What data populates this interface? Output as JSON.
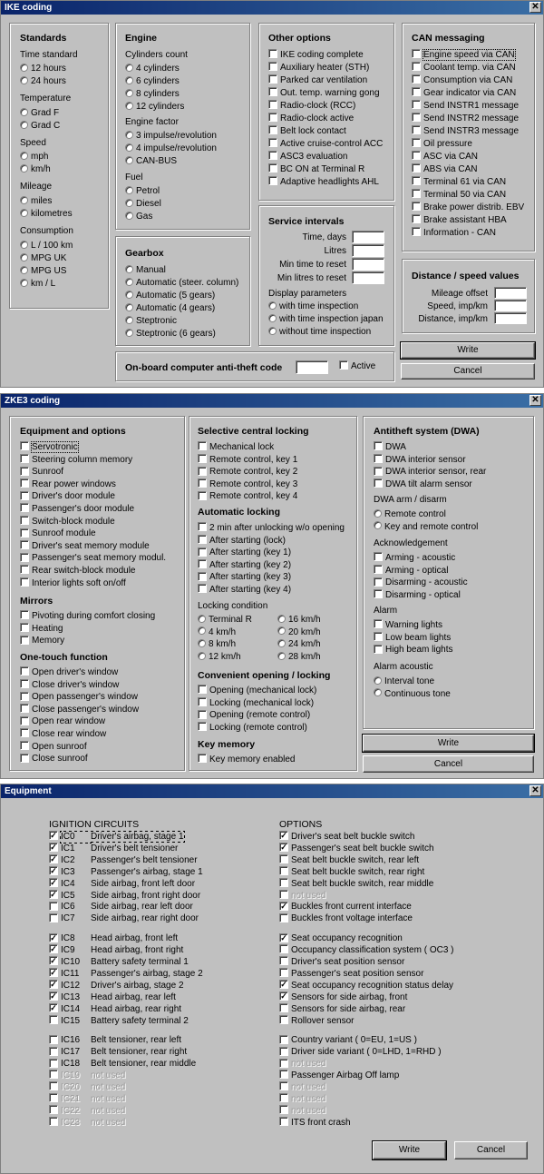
{
  "ike": {
    "title": "IKE coding",
    "standards": {
      "heading": "Standards",
      "time_label": "Time standard",
      "time_opts": [
        "12 hours",
        "24 hours"
      ],
      "temp_label": "Temperature",
      "temp_opts": [
        "Grad F",
        "Grad C"
      ],
      "speed_label": "Speed",
      "speed_opts": [
        "mph",
        "km/h"
      ],
      "mileage_label": "Mileage",
      "mileage_opts": [
        "miles",
        "kilometres"
      ],
      "cons_label": "Consumption",
      "cons_opts": [
        "L / 100 km",
        "MPG UK",
        "MPG US",
        "km / L"
      ]
    },
    "engine": {
      "heading": "Engine",
      "cyl_label": "Cylinders count",
      "cyl_opts": [
        "4 cylinders",
        "6 cylinders",
        "8 cylinders",
        "12 cylinders"
      ],
      "factor_label": "Engine factor",
      "factor_opts": [
        "3 impulse/revolution",
        "4 impulse/revolution",
        "CAN-BUS"
      ],
      "fuel_label": "Fuel",
      "fuel_opts": [
        "Petrol",
        "Diesel",
        "Gas"
      ]
    },
    "gearbox": {
      "heading": "Gearbox",
      "opts": [
        "Manual",
        "Automatic (steer. column)",
        "Automatic (5 gears)",
        "Automatic (4 gears)",
        "Steptronic",
        "Steptronic (6 gears)"
      ]
    },
    "other": {
      "heading": "Other options",
      "items": [
        "IKE coding complete",
        "Auxiliary heater (STH)",
        "Parked car ventilation",
        "Out. temp. warning gong",
        "Radio-clock (RCC)",
        "Radio-clock active",
        "Belt lock contact",
        "Active cruise-control ACC",
        "ASC3 evaluation",
        "BC ON at Terminal R",
        "Adaptive headlights AHL"
      ]
    },
    "service": {
      "heading": "Service intervals",
      "fields": [
        "Time, days",
        "Litres",
        "Min time to reset",
        "Min litres to reset"
      ],
      "display_label": "Display parameters",
      "display_opts": [
        "with time inspection",
        "with time inspection japan",
        "without time inspection"
      ]
    },
    "can": {
      "heading": "CAN messaging",
      "items": [
        "Engine speed via CAN",
        "Coolant temp. via CAN",
        "Consumption via CAN",
        "Gear indicator via CAN",
        "Send INSTR1 message",
        "Send INSTR2 message",
        "Send INSTR3 message",
        "Oil pressure",
        "ASC via CAN",
        "ABS via CAN",
        "Terminal 61 via CAN",
        "Terminal 50 via CAN",
        "Brake power distrib. EBV",
        "Brake assistant HBA",
        "Information - CAN"
      ]
    },
    "distance": {
      "heading": "Distance / speed values",
      "fields": [
        "Mileage offset",
        "Speed, imp/km",
        "Distance, imp/km"
      ]
    },
    "antitheft": {
      "label": "On-board computer anti-theft code",
      "active": "Active"
    },
    "write": "Write",
    "cancel": "Cancel"
  },
  "zke": {
    "title": "ZKE3 coding",
    "equipment": {
      "heading": "Equipment and options",
      "items": [
        "Servotronic",
        "Steering column memory",
        "Sunroof",
        "Rear power windows",
        "Driver's door module",
        "Passenger's door module",
        "Switch-block module",
        "Sunroof module",
        "Driver's seat memory module",
        "Passenger's seat memory modul.",
        "Rear switch-block module",
        "Interior lights soft on/off"
      ]
    },
    "mirrors": {
      "heading": "Mirrors",
      "items": [
        "Pivoting during comfort closing",
        "Heating",
        "Memory"
      ]
    },
    "onetouch": {
      "heading": "One-touch function",
      "items": [
        "Open driver's window",
        "Close driver's window",
        "Open passenger's window",
        "Close passenger's window",
        "Open rear window",
        "Close rear window",
        "Open sunroof",
        "Close sunroof"
      ]
    },
    "selective": {
      "heading": "Selective central locking",
      "items": [
        "Mechanical lock",
        "Remote control, key 1",
        "Remote control, key 2",
        "Remote control, key 3",
        "Remote control, key 4"
      ]
    },
    "autolock": {
      "heading": "Automatic locking",
      "items": [
        "2 min after unlocking w/o opening",
        "After starting (lock)",
        "After starting (key 1)",
        "After starting (key 2)",
        "After starting (key 3)",
        "After starting (key 4)"
      ]
    },
    "lockcond": {
      "label": "Locking condition",
      "left": [
        "Terminal R",
        "4 km/h",
        "8 km/h",
        "12 km/h"
      ],
      "right": [
        "16 km/h",
        "20 km/h",
        "24 km/h",
        "28 km/h"
      ]
    },
    "convenient": {
      "heading": "Convenient opening / locking",
      "items": [
        "Opening (mechanical lock)",
        "Locking (mechanical lock)",
        "Opening (remote control)",
        "Locking (remote control)"
      ]
    },
    "keymem": {
      "heading": "Key memory",
      "items": [
        "Key memory enabled"
      ]
    },
    "dwa": {
      "heading": "Antitheft system (DWA)",
      "items": [
        "DWA",
        "DWA interior sensor",
        "DWA interior sensor, rear",
        "DWA tilt alarm sensor"
      ],
      "arm_label": "DWA arm / disarm",
      "arm_opts": [
        "Remote control",
        "Key and remote control"
      ],
      "ack_label": "Acknowledgement",
      "ack_items": [
        "Arming - acoustic",
        "Arming - optical",
        "Disarming - acoustic",
        "Disarming - optical"
      ],
      "alarm_label": "Alarm",
      "alarm_items": [
        "Warning lights",
        "Low beam lights",
        "High beam lights"
      ],
      "acoustic_label": "Alarm acoustic",
      "acoustic_opts": [
        "Interval tone",
        "Continuous tone"
      ]
    },
    "write": "Write",
    "cancel": "Cancel"
  },
  "equip": {
    "title": "Equipment",
    "ign_heading": "IGNITION CIRCUITS",
    "opt_heading": "OPTIONS",
    "ignition": [
      {
        "code": "IC0",
        "label": "Driver's airbag, stage 1",
        "checked": true,
        "disabled": false
      },
      {
        "code": "IC1",
        "label": "Driver's belt tensioner",
        "checked": true,
        "disabled": false
      },
      {
        "code": "IC2",
        "label": "Passenger's belt tensioner",
        "checked": true,
        "disabled": false
      },
      {
        "code": "IC3",
        "label": "Passenger's airbag, stage 1",
        "checked": true,
        "disabled": false
      },
      {
        "code": "IC4",
        "label": "Side airbag, front left door",
        "checked": true,
        "disabled": false
      },
      {
        "code": "IC5",
        "label": "Side airbag, front right door",
        "checked": true,
        "disabled": false
      },
      {
        "code": "IC6",
        "label": "Side airbag, rear left door",
        "checked": false,
        "disabled": false
      },
      {
        "code": "IC7",
        "label": "Side airbag, rear right door",
        "checked": false,
        "disabled": false
      },
      {
        "code": "IC8",
        "label": "Head airbag, front left",
        "checked": true,
        "disabled": false
      },
      {
        "code": "IC9",
        "label": "Head airbag, front right",
        "checked": true,
        "disabled": false
      },
      {
        "code": "IC10",
        "label": "Battery safety terminal 1",
        "checked": true,
        "disabled": false
      },
      {
        "code": "IC11",
        "label": "Passenger's airbag, stage 2",
        "checked": true,
        "disabled": false
      },
      {
        "code": "IC12",
        "label": "Driver's airbag, stage 2",
        "checked": true,
        "disabled": false
      },
      {
        "code": "IC13",
        "label": "Head airbag, rear left",
        "checked": true,
        "disabled": false
      },
      {
        "code": "IC14",
        "label": "Head airbag, rear right",
        "checked": true,
        "disabled": false
      },
      {
        "code": "IC15",
        "label": "Battery safety terminal 2",
        "checked": false,
        "disabled": false
      },
      {
        "code": "IC16",
        "label": "Belt tensioner, rear left",
        "checked": false,
        "disabled": false
      },
      {
        "code": "IC17",
        "label": "Belt tensioner, rear right",
        "checked": false,
        "disabled": false
      },
      {
        "code": "IC18",
        "label": "Belt tensioner, rear middle",
        "checked": false,
        "disabled": false
      },
      {
        "code": "IC19",
        "label": "not used",
        "checked": false,
        "disabled": true
      },
      {
        "code": "IC20",
        "label": "not used",
        "checked": false,
        "disabled": true
      },
      {
        "code": "IC21",
        "label": "not used",
        "checked": false,
        "disabled": true
      },
      {
        "code": "IC22",
        "label": "not used",
        "checked": false,
        "disabled": true
      },
      {
        "code": "IC23",
        "label": "not used",
        "checked": false,
        "disabled": true
      }
    ],
    "options": [
      {
        "label": "Driver's seat belt buckle switch",
        "checked": true,
        "disabled": false
      },
      {
        "label": "Passenger's seat belt buckle switch",
        "checked": true,
        "disabled": false
      },
      {
        "label": "Seat belt buckle switch, rear left",
        "checked": false,
        "disabled": false
      },
      {
        "label": "Seat belt buckle switch, rear right",
        "checked": false,
        "disabled": false
      },
      {
        "label": "Seat belt buckle switch, rear middle",
        "checked": false,
        "disabled": false
      },
      {
        "label": "not used",
        "checked": false,
        "disabled": true
      },
      {
        "label": "Buckles front current interface",
        "checked": true,
        "disabled": false
      },
      {
        "label": "Buckles front voltage interface",
        "checked": false,
        "disabled": false
      },
      {
        "label": "Seat occupancy recognition",
        "checked": true,
        "disabled": false
      },
      {
        "label": "Occupancy classification system ( OC3 )",
        "checked": false,
        "disabled": false
      },
      {
        "label": "Driver's seat position sensor",
        "checked": false,
        "disabled": false
      },
      {
        "label": "Passenger's seat position sensor",
        "checked": false,
        "disabled": false
      },
      {
        "label": "Seat occupancy recognition status delay",
        "checked": true,
        "disabled": false
      },
      {
        "label": "Sensors for side airbag, front",
        "checked": true,
        "disabled": false
      },
      {
        "label": "Sensors for side airbag, rear",
        "checked": false,
        "disabled": false
      },
      {
        "label": "Rollover sensor",
        "checked": false,
        "disabled": false
      },
      {
        "label": "Country variant ( 0=EU, 1=US )",
        "checked": false,
        "disabled": false
      },
      {
        "label": "Driver side variant ( 0=LHD, 1=RHD )",
        "checked": false,
        "disabled": false
      },
      {
        "label": "not used",
        "checked": false,
        "disabled": true
      },
      {
        "label": "Passenger Airbag Off lamp",
        "checked": false,
        "disabled": false
      },
      {
        "label": "not used",
        "checked": false,
        "disabled": true
      },
      {
        "label": "not used",
        "checked": false,
        "disabled": true
      },
      {
        "label": "not used",
        "checked": false,
        "disabled": true
      },
      {
        "label": "ITS front crash",
        "checked": false,
        "disabled": false
      }
    ],
    "write": "Write",
    "cancel": "Cancel"
  },
  "icons": {
    "close": "close-icon",
    "check": "checkmark-icon"
  }
}
